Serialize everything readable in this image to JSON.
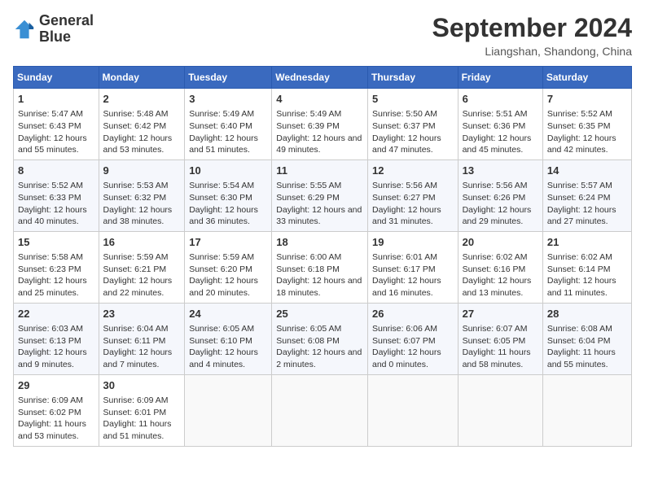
{
  "logo": {
    "line1": "General",
    "line2": "Blue"
  },
  "title": "September 2024",
  "location": "Liangshan, Shandong, China",
  "headers": [
    "Sunday",
    "Monday",
    "Tuesday",
    "Wednesday",
    "Thursday",
    "Friday",
    "Saturday"
  ],
  "weeks": [
    [
      {
        "day": "1",
        "sunrise": "5:47 AM",
        "sunset": "6:43 PM",
        "daylight": "12 hours and 55 minutes."
      },
      {
        "day": "2",
        "sunrise": "5:48 AM",
        "sunset": "6:42 PM",
        "daylight": "12 hours and 53 minutes."
      },
      {
        "day": "3",
        "sunrise": "5:49 AM",
        "sunset": "6:40 PM",
        "daylight": "12 hours and 51 minutes."
      },
      {
        "day": "4",
        "sunrise": "5:49 AM",
        "sunset": "6:39 PM",
        "daylight": "12 hours and 49 minutes."
      },
      {
        "day": "5",
        "sunrise": "5:50 AM",
        "sunset": "6:37 PM",
        "daylight": "12 hours and 47 minutes."
      },
      {
        "day": "6",
        "sunrise": "5:51 AM",
        "sunset": "6:36 PM",
        "daylight": "12 hours and 45 minutes."
      },
      {
        "day": "7",
        "sunrise": "5:52 AM",
        "sunset": "6:35 PM",
        "daylight": "12 hours and 42 minutes."
      }
    ],
    [
      {
        "day": "8",
        "sunrise": "5:52 AM",
        "sunset": "6:33 PM",
        "daylight": "12 hours and 40 minutes."
      },
      {
        "day": "9",
        "sunrise": "5:53 AM",
        "sunset": "6:32 PM",
        "daylight": "12 hours and 38 minutes."
      },
      {
        "day": "10",
        "sunrise": "5:54 AM",
        "sunset": "6:30 PM",
        "daylight": "12 hours and 36 minutes."
      },
      {
        "day": "11",
        "sunrise": "5:55 AM",
        "sunset": "6:29 PM",
        "daylight": "12 hours and 33 minutes."
      },
      {
        "day": "12",
        "sunrise": "5:56 AM",
        "sunset": "6:27 PM",
        "daylight": "12 hours and 31 minutes."
      },
      {
        "day": "13",
        "sunrise": "5:56 AM",
        "sunset": "6:26 PM",
        "daylight": "12 hours and 29 minutes."
      },
      {
        "day": "14",
        "sunrise": "5:57 AM",
        "sunset": "6:24 PM",
        "daylight": "12 hours and 27 minutes."
      }
    ],
    [
      {
        "day": "15",
        "sunrise": "5:58 AM",
        "sunset": "6:23 PM",
        "daylight": "12 hours and 25 minutes."
      },
      {
        "day": "16",
        "sunrise": "5:59 AM",
        "sunset": "6:21 PM",
        "daylight": "12 hours and 22 minutes."
      },
      {
        "day": "17",
        "sunrise": "5:59 AM",
        "sunset": "6:20 PM",
        "daylight": "12 hours and 20 minutes."
      },
      {
        "day": "18",
        "sunrise": "6:00 AM",
        "sunset": "6:18 PM",
        "daylight": "12 hours and 18 minutes."
      },
      {
        "day": "19",
        "sunrise": "6:01 AM",
        "sunset": "6:17 PM",
        "daylight": "12 hours and 16 minutes."
      },
      {
        "day": "20",
        "sunrise": "6:02 AM",
        "sunset": "6:16 PM",
        "daylight": "12 hours and 13 minutes."
      },
      {
        "day": "21",
        "sunrise": "6:02 AM",
        "sunset": "6:14 PM",
        "daylight": "12 hours and 11 minutes."
      }
    ],
    [
      {
        "day": "22",
        "sunrise": "6:03 AM",
        "sunset": "6:13 PM",
        "daylight": "12 hours and 9 minutes."
      },
      {
        "day": "23",
        "sunrise": "6:04 AM",
        "sunset": "6:11 PM",
        "daylight": "12 hours and 7 minutes."
      },
      {
        "day": "24",
        "sunrise": "6:05 AM",
        "sunset": "6:10 PM",
        "daylight": "12 hours and 4 minutes."
      },
      {
        "day": "25",
        "sunrise": "6:05 AM",
        "sunset": "6:08 PM",
        "daylight": "12 hours and 2 minutes."
      },
      {
        "day": "26",
        "sunrise": "6:06 AM",
        "sunset": "6:07 PM",
        "daylight": "12 hours and 0 minutes."
      },
      {
        "day": "27",
        "sunrise": "6:07 AM",
        "sunset": "6:05 PM",
        "daylight": "11 hours and 58 minutes."
      },
      {
        "day": "28",
        "sunrise": "6:08 AM",
        "sunset": "6:04 PM",
        "daylight": "11 hours and 55 minutes."
      }
    ],
    [
      {
        "day": "29",
        "sunrise": "6:09 AM",
        "sunset": "6:02 PM",
        "daylight": "11 hours and 53 minutes."
      },
      {
        "day": "30",
        "sunrise": "6:09 AM",
        "sunset": "6:01 PM",
        "daylight": "11 hours and 51 minutes."
      },
      null,
      null,
      null,
      null,
      null
    ]
  ]
}
